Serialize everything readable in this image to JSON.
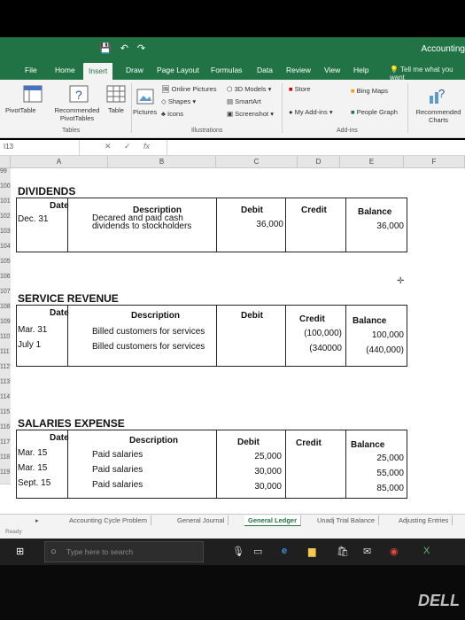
{
  "window": {
    "title": "Accounting",
    "quick_access": [
      "💾",
      "↶",
      "↷"
    ]
  },
  "ribbon_tabs": [
    "File",
    "Home",
    "Insert",
    "Draw",
    "Page Layout",
    "Formulas",
    "Data",
    "Review",
    "View",
    "Help"
  ],
  "active_tab": "Insert",
  "tell_me": "Tell me what you want",
  "ribbon": {
    "pivottable": "PivotTable",
    "recommended_pivottables": "Recommended PivotTables",
    "table": "Table",
    "group_tables": "Tables",
    "pictures": "Pictures",
    "online_pictures": "Online Pictures",
    "shapes": "Shapes",
    "icons": "Icons",
    "models3d": "3D Models",
    "smartart": "SmartArt",
    "screenshot": "Screenshot",
    "group_illustrations": "Illustrations",
    "store": "Store",
    "my_addins": "My Add-ins",
    "bing_maps": "Bing Maps",
    "people_graph": "People Graph",
    "group_addins": "Add-ins",
    "recommended_charts": "Recommended Charts"
  },
  "formula_bar": {
    "name_box": "I13",
    "fx": "fx",
    "cancel": "✕",
    "enter": "✓"
  },
  "columns": [
    "A",
    "B",
    "C",
    "D",
    "E",
    "F"
  ],
  "sections": {
    "dividends": {
      "title": "DIVIDENDS",
      "headers": {
        "date": "Date",
        "description": "Description",
        "debit": "Debit",
        "credit": "Credit",
        "balance": "Balance"
      },
      "rows": [
        {
          "date": "Dec. 31",
          "description": "Decared and paid cash dividends to stockholders",
          "debit": "36,000",
          "credit": "",
          "balance": "36,000"
        }
      ]
    },
    "service_revenue": {
      "title": "SERVICE REVENUE",
      "headers": {
        "date": "Date",
        "description": "Description",
        "debit": "Debit",
        "credit": "Credit",
        "balance": "Balance"
      },
      "rows": [
        {
          "date": "Mar. 31",
          "description": "Billed customers for services",
          "debit": "",
          "credit": "(100,000)",
          "balance": "100,000"
        },
        {
          "date": "July 1",
          "description": "Billed customers for services",
          "debit": "",
          "credit": "(340000",
          "balance": "(440,000)"
        }
      ]
    },
    "salaries_expense": {
      "title": "SALARIES EXPENSE",
      "headers": {
        "date": "Date",
        "description": "Description",
        "debit": "Debit",
        "credit": "Credit",
        "balance": "Balance"
      },
      "rows": [
        {
          "date": "Mar. 15",
          "description": "Paid salaries",
          "debit": "25,000",
          "credit": "",
          "balance": "25,000"
        },
        {
          "date": "Mar. 15",
          "description": "Paid salaries",
          "debit": "30,000",
          "credit": "",
          "balance": "55,000"
        },
        {
          "date": "Sept. 15",
          "description": "Paid salaries",
          "debit": "30,000",
          "credit": "",
          "balance": "85,000"
        }
      ]
    }
  },
  "row_numbers": [
    "99",
    "100",
    "101",
    "102",
    "103",
    "104",
    "105",
    "106",
    "107",
    "108",
    "109",
    "110",
    "111",
    "112",
    "113",
    "114",
    "115",
    "116",
    "117",
    "118",
    "119"
  ],
  "sheet_tabs": [
    "Accounting Cycle Problem",
    "General Journal",
    "General Ledger",
    "Unadj Trial Balance",
    "Adjusting Entries"
  ],
  "active_sheet": "General Ledger",
  "status": "Ready",
  "taskbar": {
    "search_placeholder": "Type here to search"
  },
  "brand": "DELL",
  "colors": {
    "excel_green": "#217346",
    "taskbar": "#1f1f1f"
  }
}
